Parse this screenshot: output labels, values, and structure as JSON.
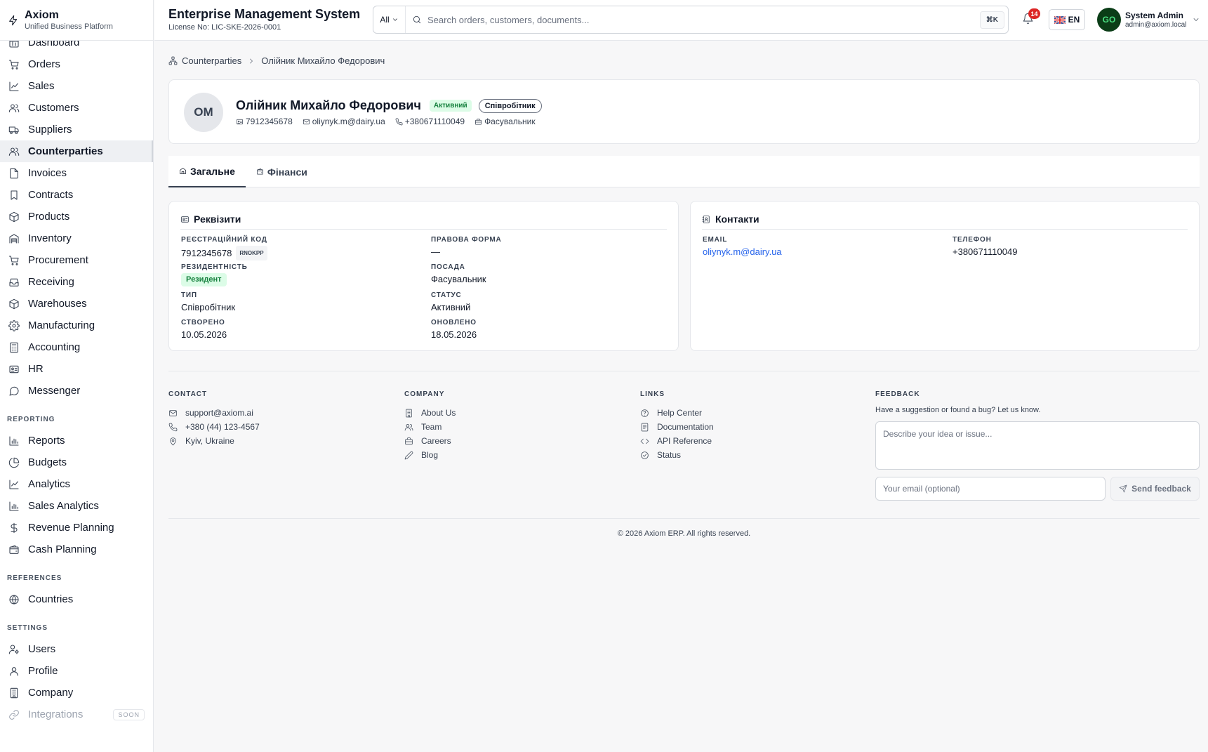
{
  "brand": {
    "name": "Axiom",
    "subtitle": "Unified Business Platform"
  },
  "sidebar": {
    "main_items": [
      {
        "label": "Dashboard",
        "icon": "dashboard-icon"
      },
      {
        "label": "Orders",
        "icon": "cart-icon"
      },
      {
        "label": "Sales",
        "icon": "trend-icon"
      },
      {
        "label": "Customers",
        "icon": "users-icon"
      },
      {
        "label": "Suppliers",
        "icon": "truck-icon"
      },
      {
        "label": "Counterparties",
        "icon": "users-icon",
        "active": true
      },
      {
        "label": "Invoices",
        "icon": "file-icon"
      },
      {
        "label": "Contracts",
        "icon": "bookmark-icon"
      },
      {
        "label": "Products",
        "icon": "box-icon"
      },
      {
        "label": "Inventory",
        "icon": "warehouse-icon"
      },
      {
        "label": "Procurement",
        "icon": "cart-icon"
      },
      {
        "label": "Receiving",
        "icon": "inbox-icon"
      },
      {
        "label": "Warehouses",
        "icon": "box-icon"
      },
      {
        "label": "Manufacturing",
        "icon": "gear-icon"
      },
      {
        "label": "Accounting",
        "icon": "calculator-icon"
      },
      {
        "label": "HR",
        "icon": "id-card-icon"
      },
      {
        "label": "Messenger",
        "icon": "chat-icon"
      }
    ],
    "reporting_title": "REPORTING",
    "reporting_items": [
      {
        "label": "Reports",
        "icon": "bar-chart-icon"
      },
      {
        "label": "Budgets",
        "icon": "pie-chart-icon"
      },
      {
        "label": "Analytics",
        "icon": "trend-icon"
      },
      {
        "label": "Sales Analytics",
        "icon": "bar-chart-icon"
      },
      {
        "label": "Revenue Planning",
        "icon": "dollar-icon"
      },
      {
        "label": "Cash Planning",
        "icon": "wallet-icon"
      }
    ],
    "references_title": "REFERENCES",
    "references_items": [
      {
        "label": "Countries",
        "icon": "globe-icon"
      }
    ],
    "settings_title": "SETTINGS",
    "settings_items": [
      {
        "label": "Users",
        "icon": "user-cog-icon"
      },
      {
        "label": "Profile",
        "icon": "user-icon"
      },
      {
        "label": "Company",
        "icon": "building-icon"
      },
      {
        "label": "Integrations",
        "icon": "link-icon",
        "badge": "SOON"
      }
    ]
  },
  "header": {
    "title": "Enterprise Management System",
    "license": "License No: LIC-SKE-2026-0001",
    "search_scope": "All",
    "search_placeholder": "Search orders, customers, documents...",
    "shortcut": "⌘K",
    "notification_count": "14",
    "language": "EN",
    "user_name": "System Admin",
    "user_email": "admin@axiom.local",
    "user_avatar_text": "GO"
  },
  "breadcrumb": {
    "parent": "Counterparties",
    "current": "Олійник Михайло Федорович"
  },
  "profile": {
    "initials": "ОМ",
    "name": "Олійник Михайло Федорович",
    "status_badge": "Активний",
    "type_badge": "Співробітник",
    "code": "7912345678",
    "email": "oliynyk.m@dairy.ua",
    "phone": "+380671110049",
    "position": "Фасувальник"
  },
  "tabs": [
    {
      "label": "Загальне",
      "icon": "home-icon",
      "active": true
    },
    {
      "label": "Фінанси",
      "icon": "wallet-icon",
      "active": false
    }
  ],
  "requisites": {
    "title": "Реквізити",
    "reg_code_label": "Реєстраційний код",
    "reg_code_value": "7912345678",
    "reg_code_chip": "RNOKPP",
    "legal_form_label": "Правова форма",
    "legal_form_value": "—",
    "residency_label": "Резидентність",
    "residency_value": "Резидент",
    "position_label": "Посада",
    "position_value": "Фасувальник",
    "type_label": "Тип",
    "type_value": "Співробітник",
    "status_label": "Статус",
    "status_value": "Активний",
    "created_label": "Створено",
    "created_value": "10.05.2026",
    "updated_label": "Оновлено",
    "updated_value": "18.05.2026"
  },
  "contacts": {
    "title": "Контакти",
    "email_label": "Email",
    "email_value": "oliynyk.m@dairy.ua",
    "phone_label": "Телефон",
    "phone_value": "+380671110049"
  },
  "footer": {
    "contact_title": "CONTACT",
    "contact_items": [
      {
        "label": "support@axiom.ai",
        "icon": "mail-icon"
      },
      {
        "label": "+380 (44) 123-4567",
        "icon": "phone-icon"
      },
      {
        "label": "Kyiv, Ukraine",
        "icon": "map-pin-icon"
      }
    ],
    "company_title": "COMPANY",
    "company_items": [
      {
        "label": "About Us",
        "icon": "building-icon"
      },
      {
        "label": "Team",
        "icon": "users-icon"
      },
      {
        "label": "Careers",
        "icon": "briefcase-icon"
      },
      {
        "label": "Blog",
        "icon": "pencil-icon"
      }
    ],
    "links_title": "LINKS",
    "links_items": [
      {
        "label": "Help Center",
        "icon": "help-circle-icon"
      },
      {
        "label": "Documentation",
        "icon": "book-icon"
      },
      {
        "label": "API Reference",
        "icon": "code-icon"
      },
      {
        "label": "Status",
        "icon": "check-circle-icon"
      }
    ],
    "feedback_title": "FEEDBACK",
    "feedback_text": "Have a suggestion or found a bug? Let us know.",
    "feedback_placeholder": "Describe your idea or issue...",
    "email_placeholder": "Your email (optional)",
    "send_label": "Send feedback",
    "copyright": "© 2026 Axiom ERP. All rights reserved."
  }
}
